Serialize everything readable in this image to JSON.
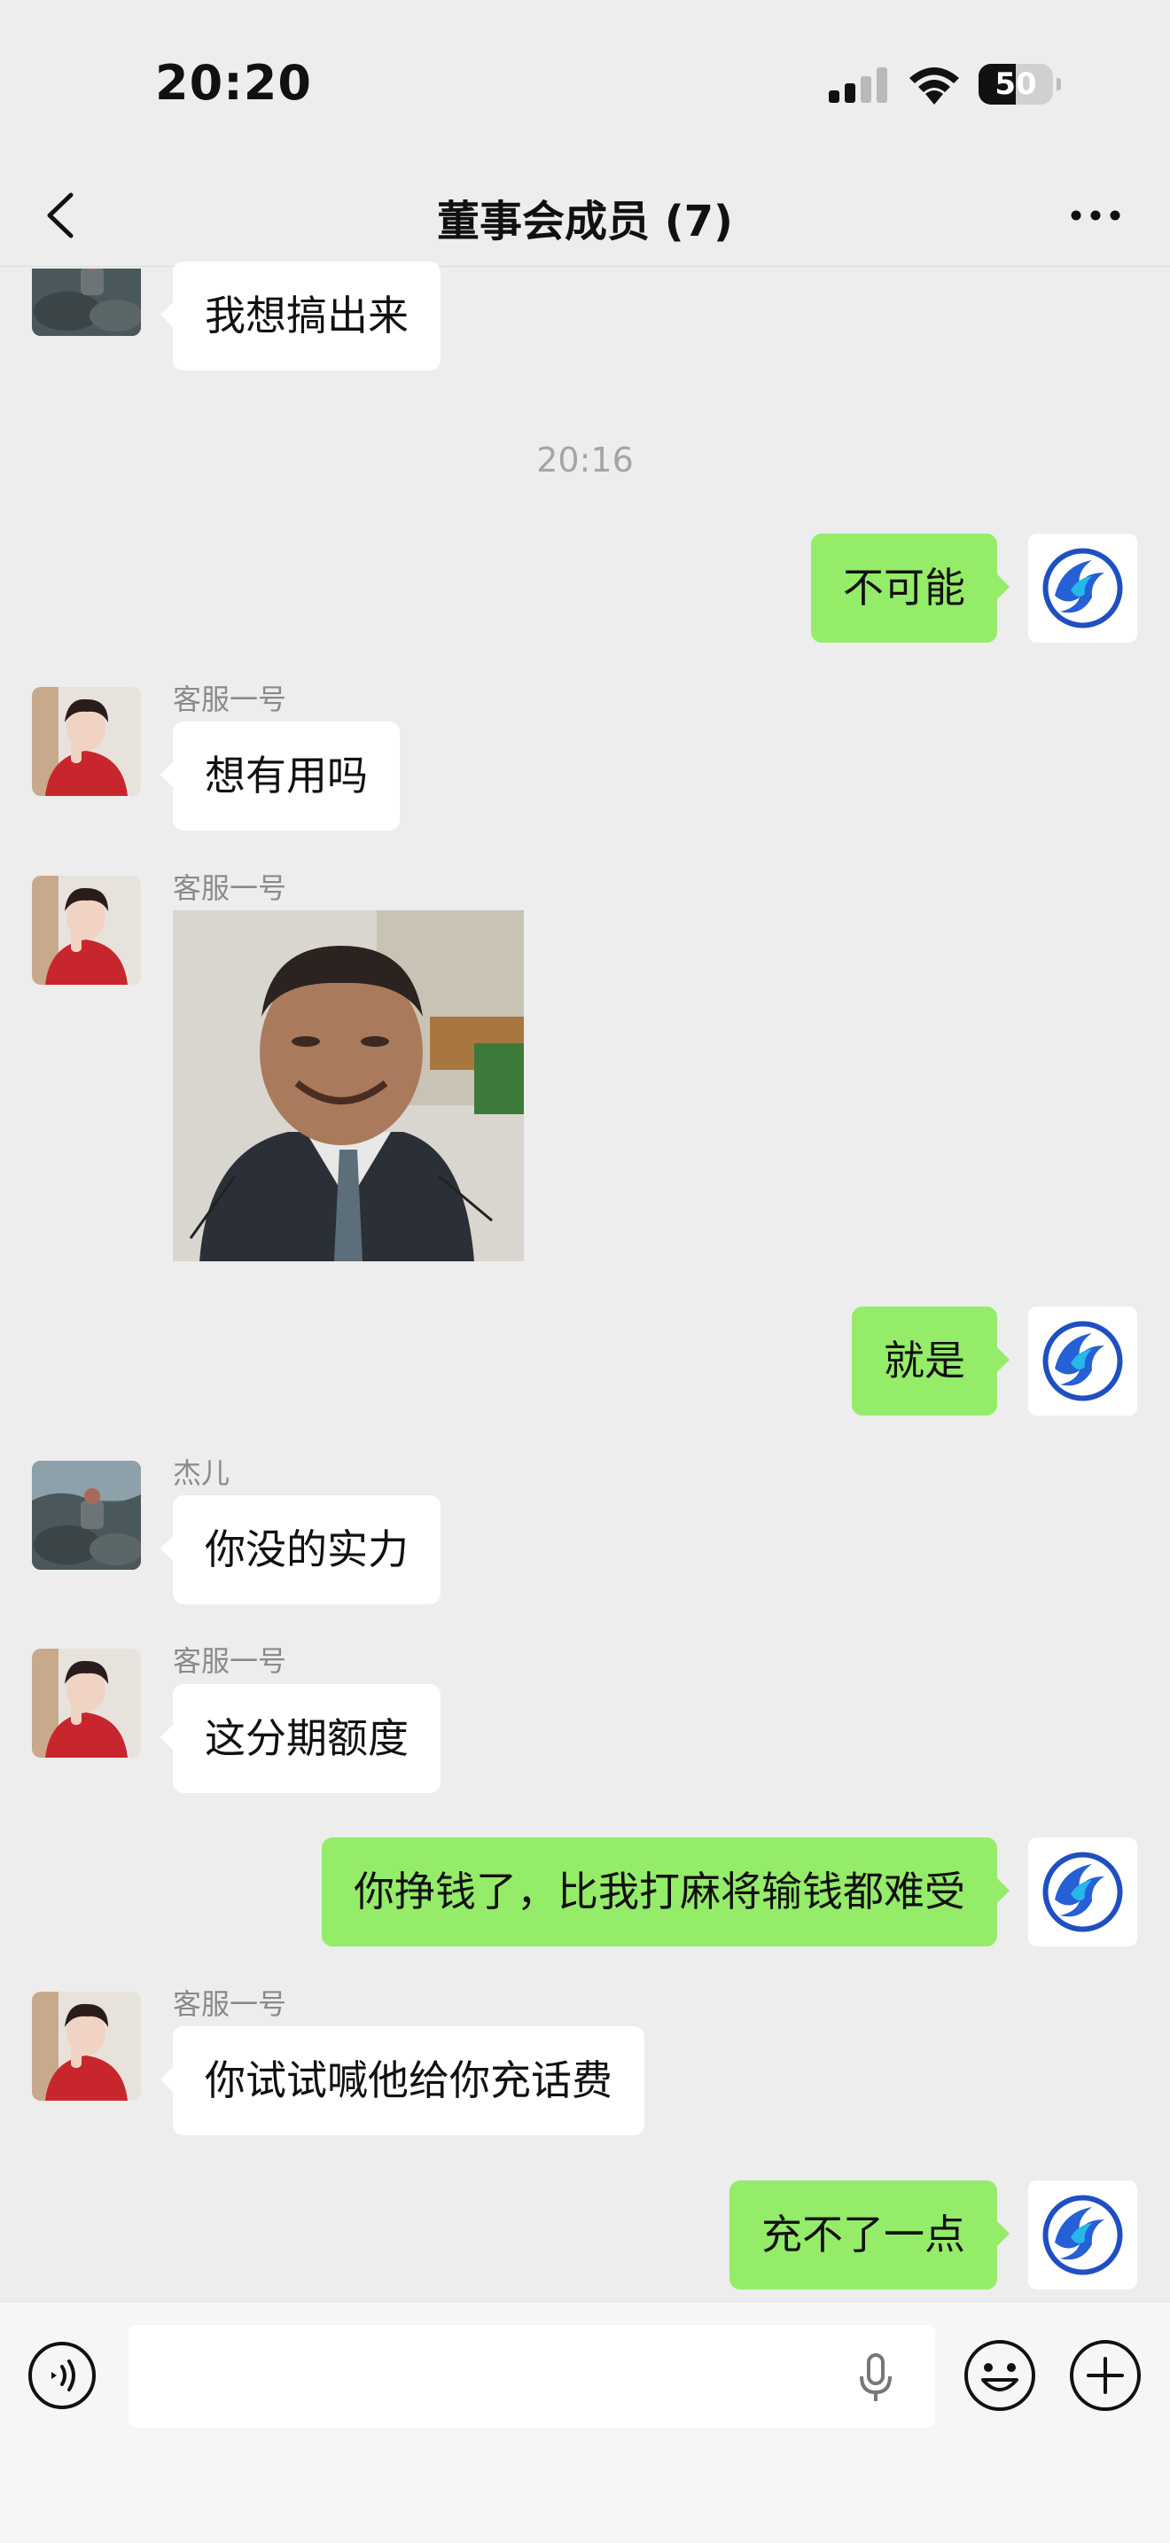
{
  "status_bar": {
    "time": "20:20",
    "battery_percent": "50",
    "battery_level": 0.5
  },
  "header": {
    "title": "董事会成员 (7)",
    "back_icon": "chevron-left-icon",
    "more_icon": "ellipsis-icon"
  },
  "timestamp": "20:16",
  "messages": [
    {
      "direction": "in",
      "avatar": "rock-landscape-avatar",
      "text": "我想搞出来"
    },
    {
      "direction": "out",
      "avatar": "blue-phoenix-logo-avatar",
      "text": "不可能"
    },
    {
      "direction": "in",
      "sender": "客服一号",
      "avatar": "red-sweater-person-avatar",
      "text": "想有用吗"
    },
    {
      "direction": "in",
      "sender": "客服一号",
      "avatar": "red-sweater-person-avatar",
      "type": "sticker",
      "sticker": "smiling-man-in-suit-sticker"
    },
    {
      "direction": "out",
      "avatar": "blue-phoenix-logo-avatar",
      "text": "就是"
    },
    {
      "direction": "in",
      "sender": "杰儿",
      "avatar": "rock-landscape-avatar",
      "text": "你没的实力"
    },
    {
      "direction": "in",
      "sender": "客服一号",
      "avatar": "red-sweater-person-avatar",
      "text": "这分期额度"
    },
    {
      "direction": "out",
      "avatar": "blue-phoenix-logo-avatar",
      "text": "你挣钱了，比我打麻将输钱都难受"
    },
    {
      "direction": "in",
      "sender": "客服一号",
      "avatar": "red-sweater-person-avatar",
      "text": "你试试喊他给你充话费"
    },
    {
      "direction": "out",
      "avatar": "blue-phoenix-logo-avatar",
      "text": "充不了一点"
    }
  ],
  "input_bar": {
    "input_value": "",
    "voice_icon": "voice-mode-icon",
    "mic_icon": "microphone-icon",
    "emoji_icon": "emoji-icon",
    "plus_icon": "plus-icon"
  },
  "colors": {
    "background": "#ededed",
    "outgoing_bubble": "#95ec69",
    "incoming_bubble": "#ffffff",
    "sender_name": "#8a8a8a"
  }
}
